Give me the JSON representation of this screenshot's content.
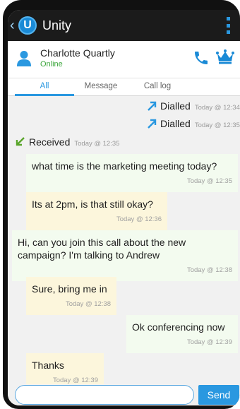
{
  "app": {
    "title": "Unity",
    "logo_letter": "U"
  },
  "contact": {
    "name": "Charlotte Quartly",
    "status": "Online"
  },
  "tabs": [
    "All",
    "Message",
    "Call log"
  ],
  "messages": [
    {
      "kind": "call",
      "direction": "dialled",
      "label": "Dialled",
      "time": "Today @ 12:34"
    },
    {
      "kind": "call",
      "direction": "dialled",
      "label": "Dialled",
      "time": "Today @ 12:35"
    },
    {
      "kind": "call",
      "direction": "received",
      "label": "Received",
      "time": "Today @ 12:35"
    },
    {
      "kind": "text",
      "sender": "contact",
      "text": "what time is the marketing meeting today?",
      "time": "Today @ 12:35"
    },
    {
      "kind": "text",
      "sender": "me",
      "text": "Its at 2pm, is that still okay?",
      "time": "Today @ 12:36"
    },
    {
      "kind": "text",
      "sender": "contact",
      "text": "Hi, can you join this call about the new campaign? I'm talking to Andrew",
      "time": "Today @ 12:38"
    },
    {
      "kind": "text",
      "sender": "me",
      "text": "Sure, bring me in",
      "time": "Today @ 12:38"
    },
    {
      "kind": "text",
      "sender": "contact",
      "text": "Ok conferencing now",
      "time": "Today @ 12:39"
    },
    {
      "kind": "text",
      "sender": "me",
      "text": "Thanks",
      "time": "Today @ 12:39"
    }
  ],
  "composer": {
    "value": "",
    "send_label": "Send"
  },
  "colors": {
    "accent": "#2a98e0",
    "dialled_arrow": "#2a98e0",
    "received_arrow": "#5aa52b",
    "online": "#3ca63c",
    "crown": "#1a8ad6",
    "incoming_bubble": "#fcf6dc",
    "outgoing_bubble": "#f3fbef"
  },
  "icons": {
    "back": "chevron-left-icon",
    "menu": "overflow-menu-icon",
    "avatar": "person-icon",
    "call": "phone-icon",
    "vip": "crown-icon",
    "dialled": "arrow-up-right-icon",
    "received": "arrow-down-left-icon"
  }
}
